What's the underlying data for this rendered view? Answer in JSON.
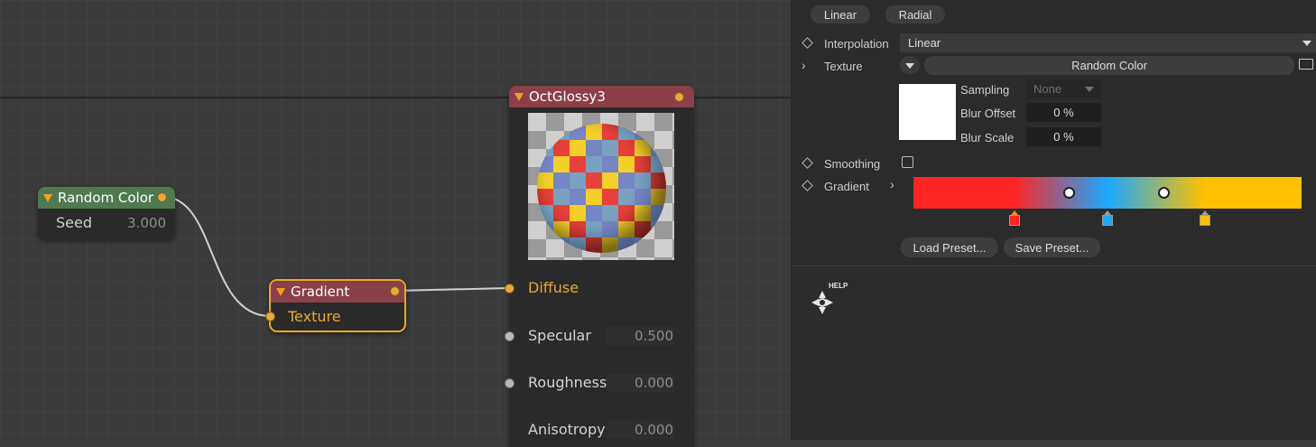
{
  "graph": {
    "random_color": {
      "title": "Random Color",
      "seed_label": "Seed",
      "seed_value": "3.000"
    },
    "gradient_node": {
      "title": "Gradient",
      "input_label": "Texture"
    },
    "material": {
      "title": "OctGlossy3",
      "pins": [
        {
          "label": "Diffuse",
          "value": ""
        },
        {
          "label": "Specular",
          "value": "0.500"
        },
        {
          "label": "Roughness",
          "value": "0.000"
        },
        {
          "label": "Anisotropy",
          "value": "0.000"
        }
      ]
    }
  },
  "panel": {
    "mode_buttons": [
      "Linear",
      "Radial"
    ],
    "interpolation": {
      "label": "Interpolation",
      "value": "Linear"
    },
    "texture": {
      "label": "Texture",
      "value": "Random Color"
    },
    "sampling": {
      "label": "Sampling",
      "value": "None"
    },
    "blur_offset": {
      "label": "Blur Offset",
      "value": "0 %"
    },
    "blur_scale": {
      "label": "Blur Scale",
      "value": "0 %"
    },
    "smoothing": {
      "label": "Smoothing",
      "checked": false
    },
    "gradient": {
      "label": "Gradient",
      "stops": [
        {
          "color": "#ff2424",
          "position": 0.26
        },
        {
          "color": "#1aa8ff",
          "position": 0.5
        },
        {
          "color": "#ffc000",
          "position": 0.75
        }
      ]
    },
    "load_preset": "Load Preset...",
    "save_preset": "Save Preset...",
    "help_label": "HELP"
  },
  "colors": {
    "pin_orange": "#e8a83a",
    "random_color_header": "#4f7a4f",
    "material_header": "#8c3f48",
    "gradient_header": "#8a4048",
    "selected_border": "#f0a820"
  }
}
